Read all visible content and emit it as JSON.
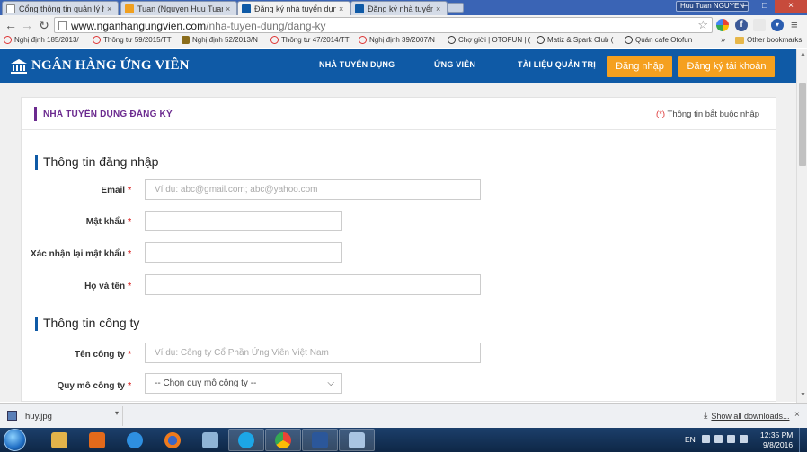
{
  "browser": {
    "tabs": [
      {
        "label": "Cổng thông tin quản lý h",
        "close": "×"
      },
      {
        "label": "Tuan (Nguyen Huu Tuan)",
        "close": "×"
      },
      {
        "label": "Đăng ký nhà tuyển dụng",
        "close": "×"
      },
      {
        "label": "Đăng ký nhà tuyển dụng",
        "close": "×"
      }
    ],
    "user_name": "Huu Tuan NGUYEN",
    "window": {
      "minimize": "–",
      "maximize": "□",
      "close": "×"
    },
    "url_host": "www.nganhangungvien.com",
    "url_path": "/nha-tuyen-dung/dang-ky",
    "ext_facebook": "f",
    "ext_last": "▾",
    "menu": "≡",
    "bookmarks": [
      {
        "label": "Nghị định 185/2013/",
        "icon": "no"
      },
      {
        "label": "Thông tư 59/2015/TT",
        "icon": "no"
      },
      {
        "label": "Nghị định 52/2013/N",
        "icon": "shield"
      },
      {
        "label": "Thông tư 47/2014/TT",
        "icon": "no"
      },
      {
        "label": "Nghị định 39/2007/N",
        "icon": "no"
      },
      {
        "label": "Chợ giời | OTOFUN | (",
        "icon": "wheel"
      },
      {
        "label": "Matiz & Spark Club (",
        "icon": "wheel"
      },
      {
        "label": "Quán cafe Otofun",
        "icon": "wheel"
      }
    ],
    "bookmarks_overflow": "»",
    "other_bookmarks": "Other bookmarks"
  },
  "site": {
    "logo_text": "NGÂN HÀNG ỨNG VIÊN",
    "nav": {
      "employer": "NHÀ TUYỂN DỤNG",
      "candidate": "ỨNG VIÊN",
      "docs": "TÀI LIỆU QUẢN TRỊ"
    },
    "login": "Đăng nhập",
    "register": "Đăng ký tài khoản",
    "brand_color": "#0f5aa6",
    "accent_color": "#f5a01f"
  },
  "form": {
    "title": "NHÀ TUYỂN DỤNG ĐĂNG KÝ",
    "required_mark": "(*)",
    "required_note": "Thông tin bắt buộc nhập",
    "section_login": "Thông tin đăng nhập",
    "section_company": "Thông tin công ty",
    "req_star": "*",
    "fields": {
      "email": {
        "label": "Email",
        "placeholder": "Ví dụ: abc@gmail.com; abc@yahoo.com",
        "value": ""
      },
      "password": {
        "label": "Mật khẩu",
        "value": ""
      },
      "confirm_password": {
        "label": "Xác nhận lại mật khẩu",
        "value": ""
      },
      "full_name": {
        "label": "Họ và tên",
        "value": ""
      },
      "company_name": {
        "label": "Tên công ty",
        "placeholder": "Ví dụ: Công ty Cổ Phần Ứng Viên Việt Nam",
        "value": ""
      },
      "company_size": {
        "label": "Quy mô công ty",
        "selected": "-- Chọn quy mô công ty --"
      }
    }
  },
  "downloads": {
    "file": "huy.jpg",
    "caret": "▾",
    "show_all": "Show all downloads...",
    "arrow": "⤓",
    "close": "×"
  },
  "taskbar": {
    "lang": "EN",
    "time": "12:35 PM",
    "date": "9/8/2016"
  }
}
